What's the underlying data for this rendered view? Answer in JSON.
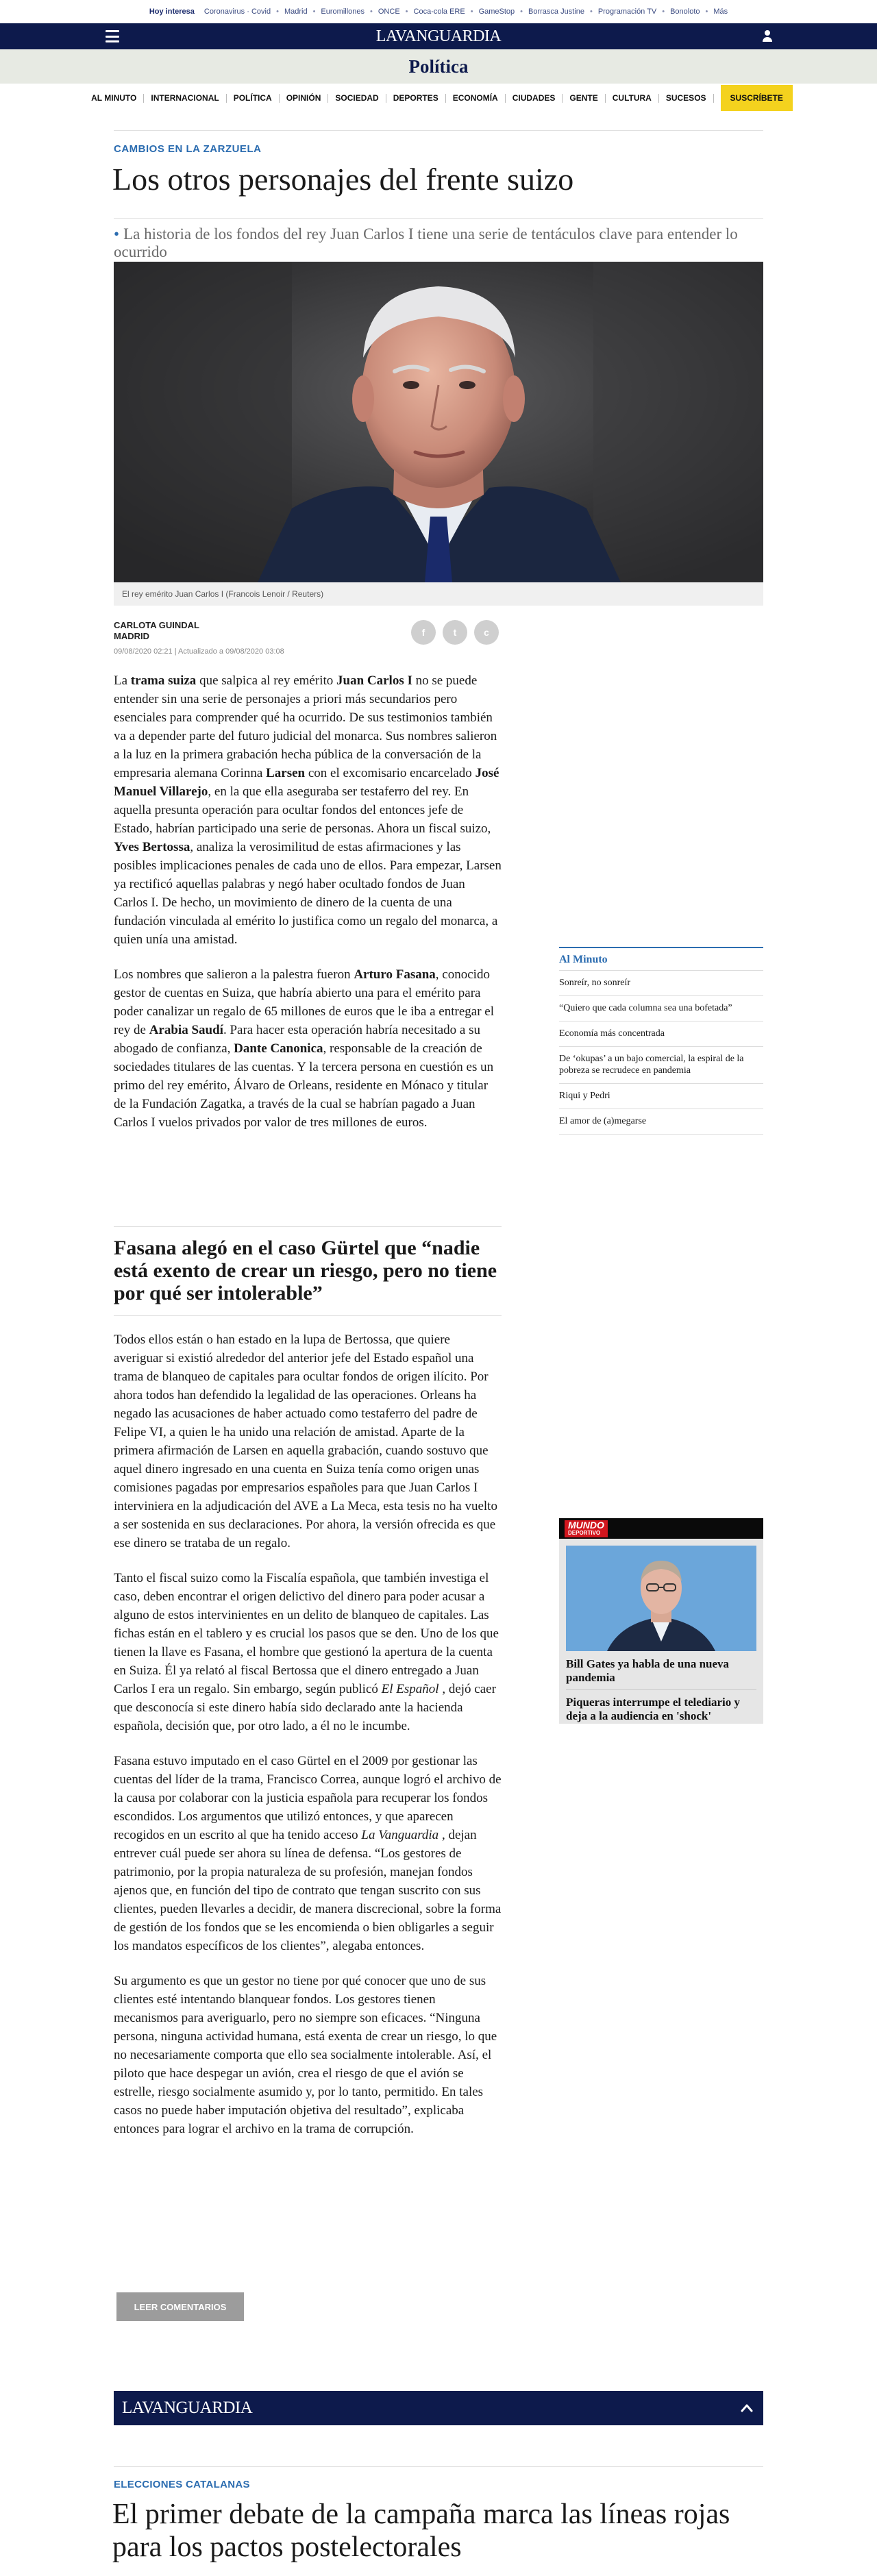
{
  "topbar": {
    "hot": "Hoy interesa",
    "links": [
      "Coronavirus · Covid",
      "Madrid",
      "Euromillones",
      "ONCE",
      "Coca-cola ERE",
      "GameStop",
      "Borrasca Justine",
      "Programación TV",
      "Bonoloto",
      "Más"
    ]
  },
  "header": {
    "logo": "LAVANGUARDIA",
    "section": "Política"
  },
  "nav": {
    "items": [
      "AL MINUTO",
      "INTERNACIONAL",
      "POLÍTICA",
      "OPINIÓN",
      "SOCIEDAD",
      "DEPORTES",
      "ECONOMÍA",
      "CIUDADES",
      "GENTE",
      "CULTURA",
      "SUCESOS"
    ],
    "subscribe": "SUSCRÍBETE"
  },
  "article": {
    "kicker": "CAMBIOS EN LA ZARZUELA",
    "title": "Los otros personajes del frente suizo",
    "deck": "La historia de los fondos del rey Juan Carlos I tiene una serie de tentáculos clave para entender lo ocurrido",
    "caption": "El rey emérito Juan Carlos I (Francois Lenoir / Reuters)",
    "author": "CARLOTA GUINDAL",
    "location": "MADRID",
    "dates": "09/08/2020 02:21  |  Actualizado a 09/08/2020 03:08",
    "share": [
      "f",
      "t",
      "c"
    ],
    "subhead": "Fasana alegó en el caso Gürtel que “nadie está exento de crear un riesgo, pero no tiene por qué ser intolerable”",
    "comments_button": "LEER COMENTARIOS"
  },
  "sidebar": {
    "al_minuto": {
      "heading": "Al Minuto",
      "items": [
        "Sonreír, no sonreír",
        "“Quiero que cada columna sea una bofetada”",
        "Economía más concentrada",
        "De ‘okupas’ a un bajo comercial, la espiral de la pobreza se recrudece en pandemia",
        "Riqui y Pedri",
        "El amor de (a)megarse"
      ]
    },
    "mundo_deportivo": {
      "logo_main": "MUNDO",
      "logo_sub": "DEPORTIVO",
      "headline1": "Bill Gates ya habla de una nueva pandemia",
      "headline2": "Piqueras interrumpe el telediario y deja a la audiencia en 'shock'"
    }
  },
  "footer": {
    "logo": "LAVANGUARDIA"
  },
  "next": {
    "kicker": "ELECCIONES CATALANAS",
    "title": "El primer debate de la campaña marca las líneas rojas para los pactos postelectorales"
  }
}
